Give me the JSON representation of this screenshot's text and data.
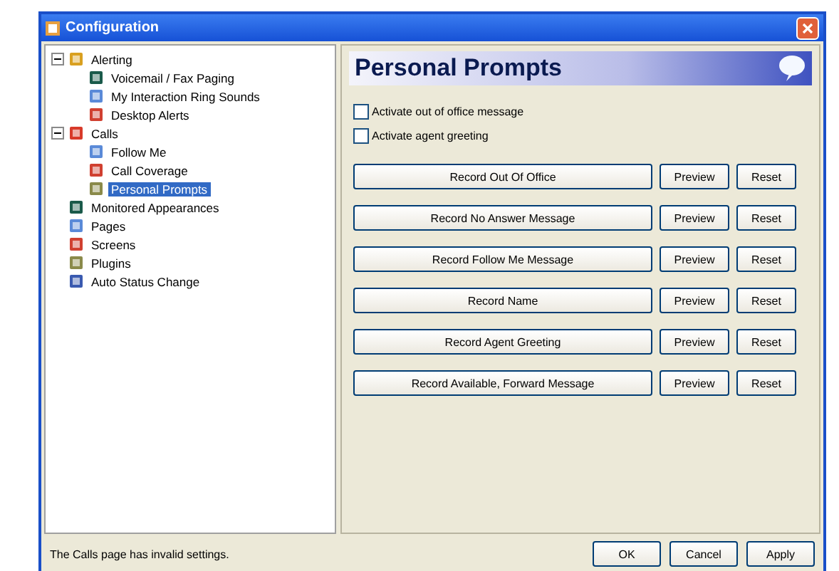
{
  "window": {
    "title": "Configuration"
  },
  "tree": [
    {
      "label": "Alerting",
      "expanded": true,
      "selected": false,
      "children": [
        {
          "label": "Voicemail / Fax Paging",
          "selected": false
        },
        {
          "label": "My Interaction Ring Sounds",
          "selected": false
        },
        {
          "label": "Desktop Alerts",
          "selected": false
        }
      ]
    },
    {
      "label": "Calls",
      "expanded": true,
      "selected": false,
      "children": [
        {
          "label": "Follow Me",
          "selected": false
        },
        {
          "label": "Call Coverage",
          "selected": false
        },
        {
          "label": "Personal Prompts",
          "selected": true
        }
      ]
    },
    {
      "label": "Monitored Appearances",
      "selected": false
    },
    {
      "label": "Pages",
      "selected": false
    },
    {
      "label": "Screens",
      "selected": false
    },
    {
      "label": "Plugins",
      "selected": false
    },
    {
      "label": "Auto Status Change",
      "selected": false
    }
  ],
  "panel": {
    "title": "Personal Prompts",
    "checkboxes": [
      {
        "label": "Activate out of office message",
        "checked": false
      },
      {
        "label": "Activate agent greeting",
        "checked": false
      }
    ],
    "prompts": [
      {
        "record": "Record Out Of Office",
        "preview": "Preview",
        "reset": "Reset"
      },
      {
        "record": "Record No Answer Message",
        "preview": "Preview",
        "reset": "Reset"
      },
      {
        "record": "Record Follow Me Message",
        "preview": "Preview",
        "reset": "Reset"
      },
      {
        "record": "Record Name",
        "preview": "Preview",
        "reset": "Reset"
      },
      {
        "record": "Record Agent Greeting",
        "preview": "Preview",
        "reset": "Reset"
      },
      {
        "record": "Record Available, Forward Message",
        "preview": "Preview",
        "reset": "Reset"
      }
    ]
  },
  "status_bar": {
    "message": "The Calls page has invalid settings."
  },
  "buttons": [
    "OK",
    "Cancel",
    "Apply"
  ]
}
